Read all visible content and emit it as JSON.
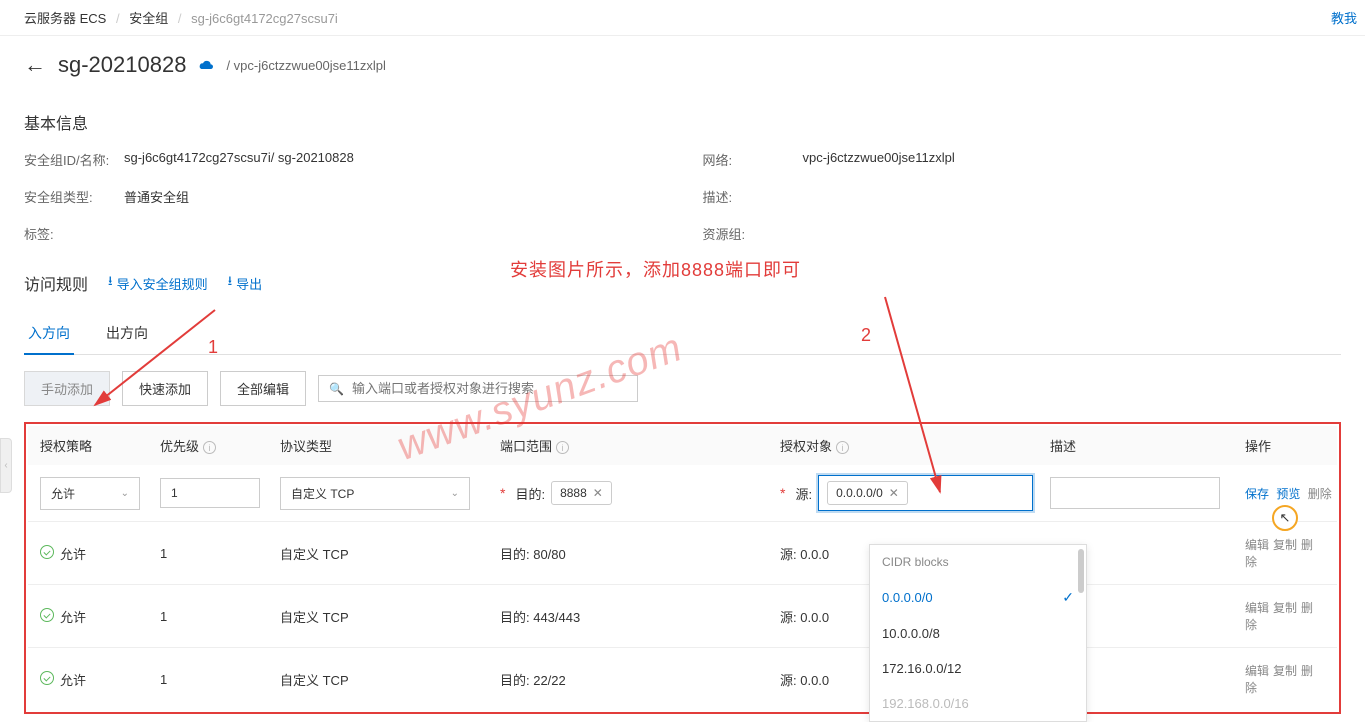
{
  "breadcrumb": {
    "a": "云服务器 ECS",
    "b": "安全组",
    "c": "sg-j6c6gt4172cg27scsu7i"
  },
  "topLink": "教我",
  "header": {
    "title": "sg-20210828",
    "sub": "/ vpc-j6ctzzwue00jse11zxlpl"
  },
  "basic": {
    "title": "基本信息",
    "idLabel": "安全组ID/名称:",
    "idValue": "sg-j6c6gt4172cg27scsu7i/ sg-20210828",
    "netLabel": "网络:",
    "netValue": "vpc-j6ctzzwue00jse11zxlpl",
    "typeLabel": "安全组类型:",
    "typeValue": "普通安全组",
    "descLabel": "描述:",
    "tagLabel": "标签:",
    "resLabel": "资源组:"
  },
  "rules": {
    "title": "访问规则",
    "importBtn": "导入安全组规则",
    "exportBtn": "导出",
    "tabIn": "入方向",
    "tabOut": "出方向",
    "btnManual": "手动添加",
    "btnQuick": "快速添加",
    "btnEditAll": "全部编辑",
    "searchPlaceholder": "输入端口或者授权对象进行搜索",
    "thPolicy": "授权策略",
    "thPriority": "优先级",
    "thProto": "协议类型",
    "thPort": "端口范围",
    "thTarget": "授权对象",
    "thDesc": "描述",
    "thOps": "操作"
  },
  "editRow": {
    "policy": "允许",
    "priority": "1",
    "proto": "自定义 TCP",
    "destLabel": "目的:",
    "portTag": "8888",
    "srcLabel": "源:",
    "srcTag": "0.0.0.0/0",
    "saveBtn": "保存",
    "previewBtn": "预览",
    "deleteBtn": "删除"
  },
  "dropdown": {
    "header": "CIDR blocks",
    "opt1": "0.0.0.0/0",
    "opt2": "10.0.0.0/8",
    "opt3": "172.16.0.0/12",
    "opt4": "192.168.0.0/16"
  },
  "rows": [
    {
      "policy": "允许",
      "priority": "1",
      "proto": "自定义 TCP",
      "port": "目的: 80/80",
      "target": "源: 0.0.0",
      "ops": {
        "edit": "编辑",
        "copy": "复制",
        "del": "删除"
      }
    },
    {
      "policy": "允许",
      "priority": "1",
      "proto": "自定义 TCP",
      "port": "目的: 443/443",
      "target": "源: 0.0.0",
      "ops": {
        "edit": "编辑",
        "copy": "复制",
        "del": "删除"
      }
    },
    {
      "policy": "允许",
      "priority": "1",
      "proto": "自定义 TCP",
      "port": "目的: 22/22",
      "target": "源: 0.0.0",
      "ops": {
        "edit": "编辑",
        "copy": "复制",
        "del": "删除"
      }
    }
  ],
  "annotation": {
    "text": "安装图片所示，添加8888端口即可",
    "num1": "1",
    "num2": "2"
  },
  "watermark": "www.syunz.com"
}
